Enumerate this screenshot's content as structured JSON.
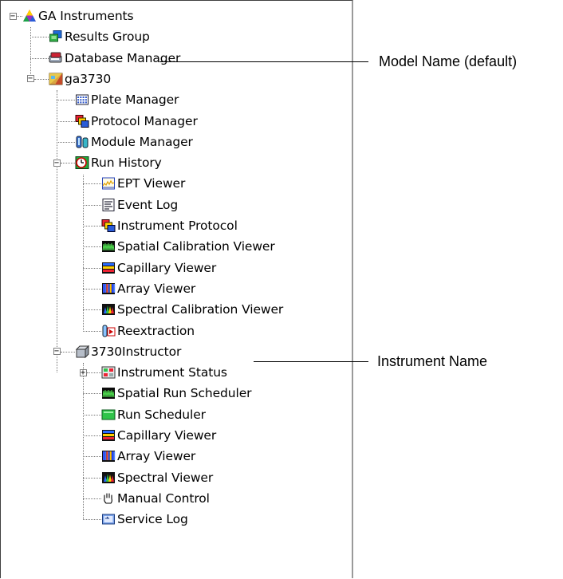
{
  "tree": {
    "root": {
      "label": "GA Instruments",
      "icon": "ga-instruments-triangle-icon",
      "expanded": true
    },
    "results_group": {
      "label": "Results Group",
      "icon": "results-group-icon"
    },
    "database_manager": {
      "label": "Database Manager",
      "icon": "database-manager-icon"
    },
    "model": {
      "label": "ga3730",
      "icon": "model-icon",
      "expanded": true,
      "children": [
        {
          "label": "Plate Manager",
          "icon": "plate-manager-icon"
        },
        {
          "label": "Protocol Manager",
          "icon": "protocol-manager-icon"
        },
        {
          "label": "Module Manager",
          "icon": "module-manager-icon"
        }
      ],
      "run_history": {
        "label": "Run History",
        "icon": "run-history-icon",
        "expanded": true,
        "children": [
          {
            "label": "EPT Viewer",
            "icon": "ept-viewer-icon"
          },
          {
            "label": "Event Log",
            "icon": "event-log-icon"
          },
          {
            "label": "Instrument Protocol",
            "icon": "instrument-protocol-icon"
          },
          {
            "label": "Spatial Calibration Viewer",
            "icon": "spatial-calibration-icon"
          },
          {
            "label": "Capillary Viewer",
            "icon": "capillary-viewer-icon"
          },
          {
            "label": "Array Viewer",
            "icon": "array-viewer-icon"
          },
          {
            "label": "Spectral Calibration Viewer",
            "icon": "spectral-calibration-icon"
          },
          {
            "label": "Reextraction",
            "icon": "reextraction-icon"
          }
        ]
      }
    },
    "instrument": {
      "label": "3730Instructor",
      "icon": "instrument-icon",
      "expanded": true,
      "children": [
        {
          "label": "Instrument Status",
          "icon": "instrument-status-icon",
          "expandable": true
        },
        {
          "label": "Spatial Run Scheduler",
          "icon": "spatial-run-scheduler-icon"
        },
        {
          "label": "Run Scheduler",
          "icon": "run-scheduler-icon"
        },
        {
          "label": "Capillary Viewer",
          "icon": "capillary-viewer-icon"
        },
        {
          "label": "Array Viewer",
          "icon": "array-viewer-icon"
        },
        {
          "label": "Spectral Viewer",
          "icon": "spectral-viewer-icon"
        },
        {
          "label": "Manual Control",
          "icon": "hand-icon"
        },
        {
          "label": "Service Log",
          "icon": "service-log-icon"
        }
      ]
    }
  },
  "callouts": {
    "model_name": "Model Name (default)",
    "instrument_name": "Instrument Name"
  }
}
